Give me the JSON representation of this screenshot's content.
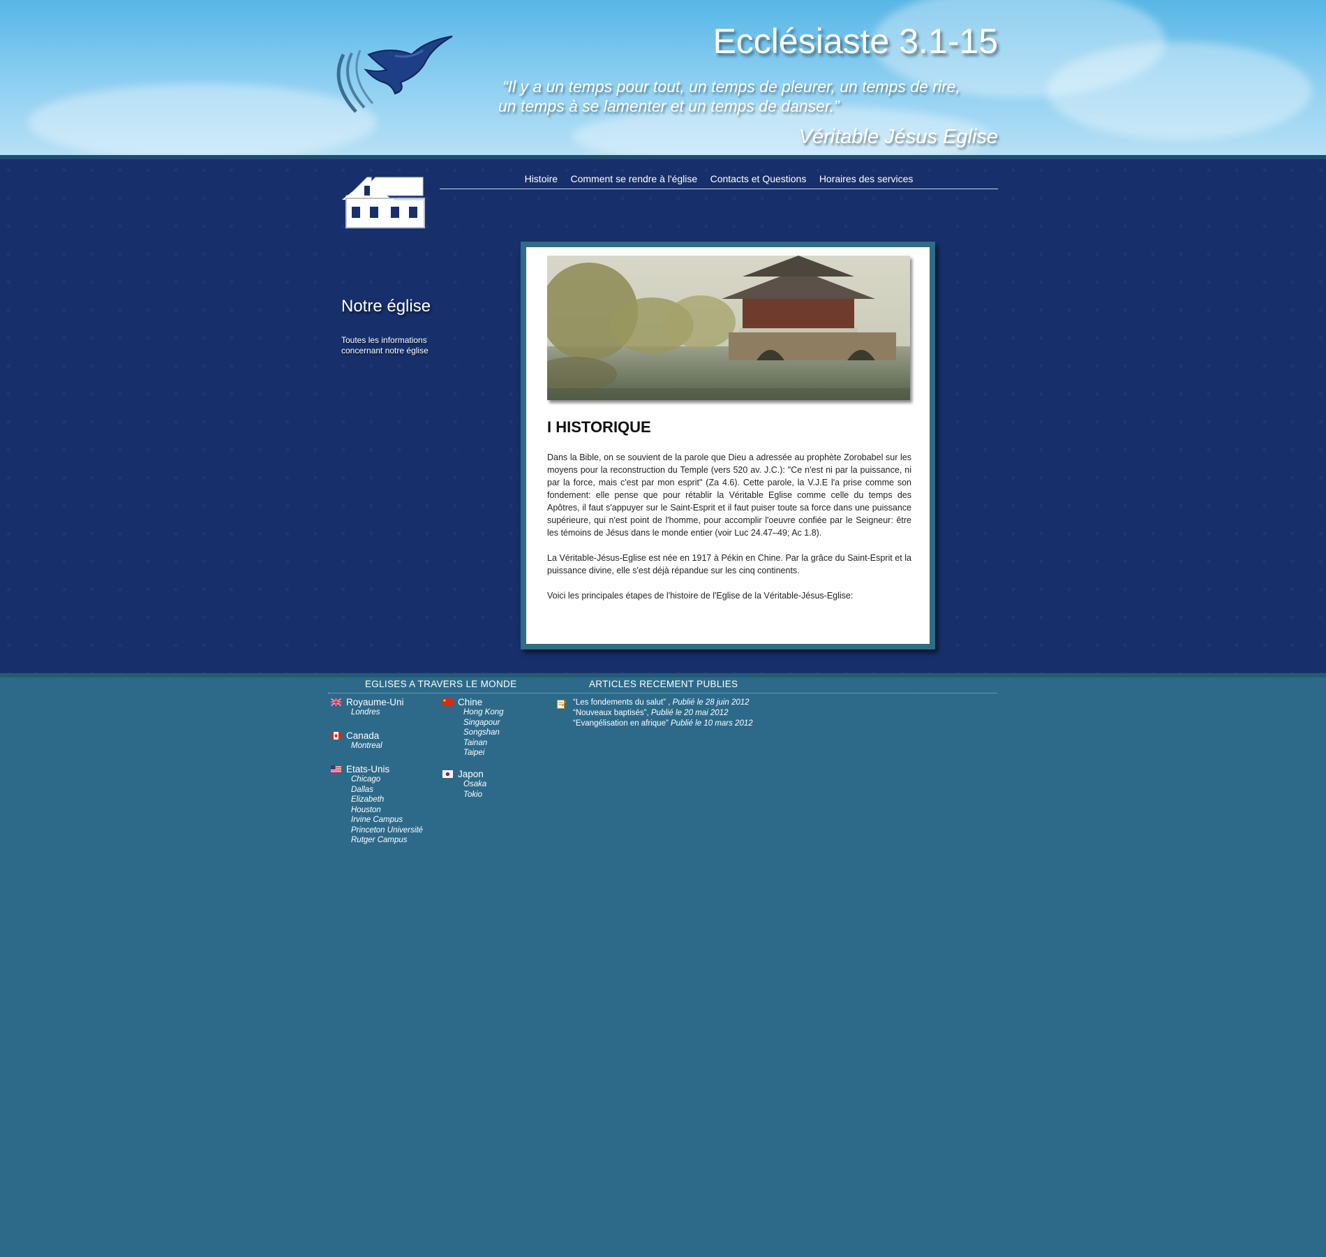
{
  "header": {
    "title": "Ecclésiaste 3.1-15",
    "quote_line1": "“Il y a un temps pour tout, un temps de pleurer, un temps de rire,",
    "quote_line2": "un temps à se lamenter et un temps de danser.”",
    "signature": "Véritable Jésus Eglise"
  },
  "nav": {
    "items": [
      "Histoire",
      "Comment se rendre à l'église",
      "Contacts et Questions",
      "Horaires des services"
    ]
  },
  "sidebar": {
    "title": "Notre église",
    "description": "Toutes les informations concernant notre église"
  },
  "content": {
    "heading": "I HISTORIQUE",
    "paragraphs": [
      "Dans la Bible, on se souvient de la parole que Dieu a adressée au prophète Zorobabel sur les moyens pour la reconstruction du Temple (vers 520 av. J.C.): \"Ce n'est ni par la puissance, ni par la force, mais c'est par mon esprit\" (Za 4.6). Cette parole, la V.J.E l'a prise comme son fondement: elle pense que pour rétablir la Véritable Eglise comme celle du temps des Apôtres, il faut s'appuyer sur le Saint-Esprit et il faut puiser toute sa force dans une puissance supérieure, qui n'est point de l'homme, pour accomplir l'oeuvre confiée par le Seigneur: être les témoins de Jésus dans le monde entier (voir Luc 24.47–49; Ac 1.8).",
      "La Véritable-Jésus-Eglise est née en 1917 à Pékin en Chine. Par la grâce du Saint-Esprit et la puissance divine, elle s'est déjà répandue sur les cinq continents.",
      "Voici les principales étapes de l'histoire de l'Eglise de la Véritable-Jésus-Eglise:"
    ]
  },
  "footer": {
    "churches_heading": "EGLISES A TRAVERS LE MONDE",
    "articles_heading": "ARTICLES RECEMENT PUBLIES",
    "countries": [
      {
        "name": "Royaume-Uni",
        "flag": "uk-flag-icon",
        "cities": [
          "Londres"
        ]
      },
      {
        "name": "Canada",
        "flag": "canada-flag-icon",
        "cities": [
          "Montreal"
        ]
      },
      {
        "name": "Etats-Unis",
        "flag": "usa-flag-icon",
        "cities": [
          "Chicago",
          "Dallas",
          "Elizabeth",
          "Houston",
          "Irvine Campus",
          "Princeton Université",
          "Rutger Campus"
        ]
      },
      {
        "name": "Chine",
        "flag": "china-flag-icon",
        "cities": [
          "Hong Kong",
          "Singapour",
          "Songshan",
          "Tainan",
          "Taipei"
        ]
      },
      {
        "name": "Japon",
        "flag": "japan-flag-icon",
        "cities": [
          "Osaka",
          "Tokio"
        ]
      }
    ],
    "articles": [
      {
        "title": "“Les fondements du salut” ,",
        "date": "Publié le 28 juin 2012"
      },
      {
        "title": "“Nouveaux baptisés”,",
        "date": "Publié le 20 mai 2012"
      },
      {
        "title": "“Evangélisation en afrique”",
        "date": "Publié le 10 mars 2012"
      }
    ]
  }
}
